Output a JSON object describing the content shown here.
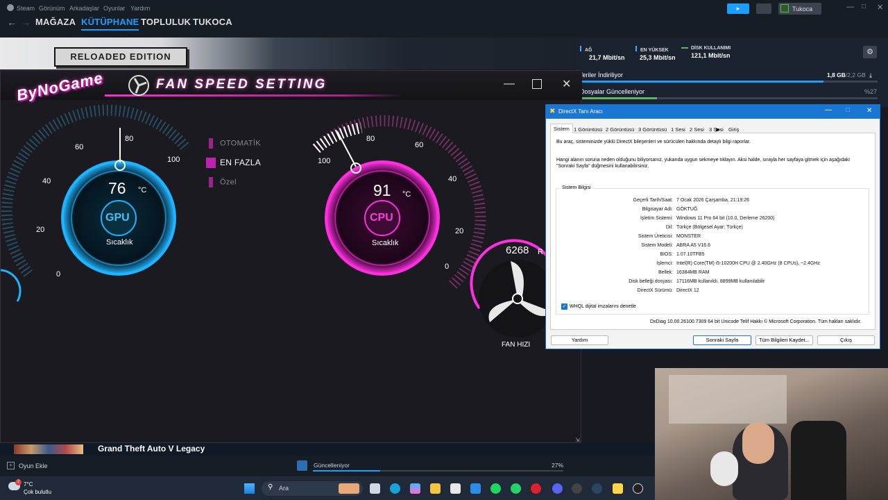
{
  "steam": {
    "menu": [
      "Steam",
      "Görünüm",
      "Arkadaşlar",
      "Oyunlar",
      "Yardım"
    ],
    "nav": [
      "MAĞAZA",
      "KÜTÜPHANE",
      "TOPLULUK",
      "TUKOCA"
    ],
    "user": "Tukoca",
    "hero_badge": "RELOADED EDITION",
    "stats": [
      {
        "label": "AĞ",
        "value": "21,7 Mbit/sn",
        "color": "#4ea7ff"
      },
      {
        "label": "EN YÜKSEK",
        "value": "25,3 Mbit/sn",
        "color": "#4ea7ff"
      },
      {
        "label": "DİSK KULLANIMI",
        "value": "121,1 Mbit/sn",
        "color": "#5cb85c"
      }
    ],
    "download_row1_label": "Veriler İndiriliyor",
    "download_row1_value": "1,8 GB",
    "download_row1_total": "/2,2 GB",
    "download_row2_label": "Dosyalar Güncelleniyor",
    "download_row2_value": "%27",
    "game_title": "Grand Theft Auto V Legacy",
    "add_game": "Oyun Ekle",
    "update_status": "Güncelleniyor",
    "update_percent": "27%",
    "update_progress": 0.27
  },
  "fan": {
    "brand": "ByNoGame",
    "title": "FAN SPEED SETTING",
    "modes": [
      {
        "label": "OTOMATİK",
        "active": false
      },
      {
        "label": "EN FAZLA",
        "active": true
      },
      {
        "label": "Özel",
        "active": false
      }
    ],
    "gpu": {
      "temp": "76",
      "unit": "°C",
      "name": "GPU",
      "caption": "Sıcaklık",
      "ticks": [
        "0",
        "20",
        "40",
        "60",
        "80",
        "100"
      ]
    },
    "cpu": {
      "temp": "91",
      "unit": "°C",
      "name": "CPU",
      "caption": "Sıcaklık",
      "ticks": [
        "100",
        "80",
        "60",
        "40",
        "20",
        "0"
      ]
    },
    "fan_speed": {
      "value": "6268",
      "unit": "R",
      "caption": "FAN HIZI"
    }
  },
  "dx": {
    "title": "DirectX Tanı Aracı",
    "tabs": [
      "Sistem",
      "1 Görüntüsü",
      "2 Görüntüsü",
      "3 Görüntüsü",
      "1 Sesi",
      "2 Sesi",
      "3 Sesi",
      "Giriş"
    ],
    "intro": "Bu araç, sisteminizde yüklü DirectX bileşenleri ve sürücüleri hakkında detaylı bilgi raporlar.",
    "help_line1": "Hangi alanın soruna neden olduğunu biliyorsanız, yukarıda uygun sekmeye tıklayın. Aksi halde, sırayla her sayfaya gitmek için aşağıdaki",
    "help_line2": "\"Sonraki Sayfa\" düğmesini kullanabilirsiniz.",
    "section": "Sistem Bilgisi",
    "rows": [
      {
        "label": "Geçerli Tarih/Saat:",
        "value": "7 Ocak 2026 Çarşamba, 21:19:26"
      },
      {
        "label": "Bilgisayar Adı:",
        "value": "GÖKTUĞ"
      },
      {
        "label": "İşletim Sistemi:",
        "value": "Windows 11 Pro 64 bit (10.0, Derleme 26200)"
      },
      {
        "label": "Dil:",
        "value": "Türkçe (Bölgesel Ayar: Türkçe)"
      },
      {
        "label": "Sistem Üreticisi:",
        "value": "MONSTER"
      },
      {
        "label": "Sistem Modeli:",
        "value": "ABRA A5 V16.6"
      },
      {
        "label": "BIOS:",
        "value": "1.07.10TFB5"
      },
      {
        "label": "İşlemci:",
        "value": "Intel(R) Core(TM) i5-10200H CPU @ 2.40GHz (8 CPUs), ~2.4GHz"
      },
      {
        "label": "Bellek:",
        "value": "16384MB RAM"
      },
      {
        "label": "Disk belleği dosyası:",
        "value": "17116MB kullanıldı, 8899MB kullanılabilir"
      },
      {
        "label": "DirectX Sürümü:",
        "value": "DirectX 12"
      }
    ],
    "whql": "WHQL dijital imzalarını denetle",
    "footer": "DxDiag 10.00.26100.7309 64 bit Unicode  Telif Hakkı © Microsoft Corporation. Tüm hakları saklıdır.",
    "buttons": {
      "help": "Yardım",
      "next": "Sonraki Sayfa",
      "save": "Tüm Bilgileri Kaydet...",
      "exit": "Çıkış"
    }
  },
  "taskbar": {
    "weather_temp": "7°C",
    "weather_desc": "Çok bulutlu",
    "search": "Ara",
    "badge": "2"
  }
}
